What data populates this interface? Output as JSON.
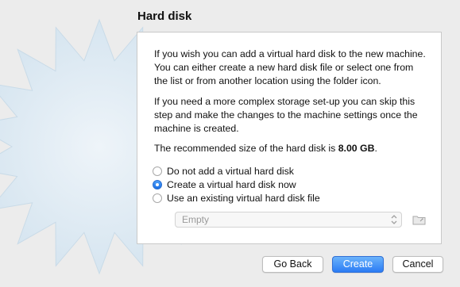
{
  "page": {
    "title": "Hard disk"
  },
  "info": {
    "paragraph1": "If you wish you can add a virtual hard disk to the new machine. You can either create a new hard disk file or select one from the list or from another location using the folder icon.",
    "paragraph2": "If you need a more complex storage set-up you can skip this step and make the changes to the machine settings once the machine is created.",
    "recommended_prefix": "The recommended size of the hard disk is ",
    "recommended_size": "8.00 GB",
    "recommended_suffix": "."
  },
  "options": [
    {
      "label": "Do not add a virtual hard disk",
      "selected": false
    },
    {
      "label": "Create a virtual hard disk now",
      "selected": true
    },
    {
      "label": "Use an existing virtual hard disk file",
      "selected": false
    }
  ],
  "disk_select": {
    "value": "Empty"
  },
  "icons": {
    "select_chevron": "up-down-chevron-icon",
    "folder": "folder-icon",
    "background": "starburst-icon"
  },
  "buttons": {
    "back": "Go Back",
    "create": "Create",
    "cancel": "Cancel"
  },
  "colors": {
    "accent": "#2b7cf4",
    "starburst": "#dbe8f1"
  }
}
